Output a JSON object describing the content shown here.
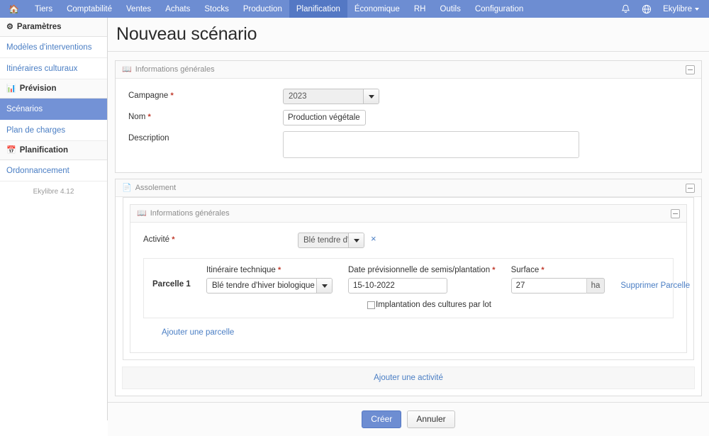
{
  "topnav": {
    "home_icon": "home-icon",
    "items": [
      {
        "label": "Tiers",
        "active": false
      },
      {
        "label": "Comptabilité",
        "active": false
      },
      {
        "label": "Ventes",
        "active": false
      },
      {
        "label": "Achats",
        "active": false
      },
      {
        "label": "Stocks",
        "active": false
      },
      {
        "label": "Production",
        "active": false
      },
      {
        "label": "Planification",
        "active": true
      },
      {
        "label": "Économique",
        "active": false
      },
      {
        "label": "RH",
        "active": false
      },
      {
        "label": "Outils",
        "active": false
      },
      {
        "label": "Configuration",
        "active": false
      }
    ],
    "bell_icon": "bell-icon",
    "globe_icon": "globe-icon",
    "user_label": "Ekylibre",
    "accent_color": "#6d8dd2",
    "active_color": "#5478c4"
  },
  "sidebar": {
    "sections": [
      {
        "title": "Paramètres",
        "icon": "gear-icon",
        "links": [
          {
            "label": "Modèles d'interventions",
            "selected": false
          },
          {
            "label": "Itinéraires culturaux",
            "selected": false
          }
        ]
      },
      {
        "title": "Prévision",
        "icon": "chart-bar-icon",
        "links": [
          {
            "label": "Scénarios",
            "selected": true
          },
          {
            "label": "Plan de charges",
            "selected": false
          }
        ]
      },
      {
        "title": "Planification",
        "icon": "calendar-icon",
        "links": [
          {
            "label": "Ordonnancement",
            "selected": false
          }
        ]
      }
    ],
    "version": "Ekylibre 4.12",
    "selected_bg": "#7392d6",
    "link_color": "#4a7ec4"
  },
  "page": {
    "title": "Nouveau scénario"
  },
  "panel_infos": {
    "icon": "book-icon",
    "title": "Informations générales",
    "collapse_icon": "collapse-minus-icon",
    "fields": {
      "campagne": {
        "label": "Campagne",
        "required_mark": "*",
        "value": "2023",
        "dropdown_icon": "chevron-down-icon"
      },
      "nom": {
        "label": "Nom",
        "required_mark": "*",
        "value": "Production végétale",
        "placeholder": ""
      },
      "description": {
        "label": "Description",
        "value": "",
        "placeholder": ""
      }
    }
  },
  "panel_assolement": {
    "icon": "file-icon",
    "title": "Assolement",
    "collapse_icon": "collapse-minus-icon",
    "inner": {
      "icon": "book-icon",
      "title": "Informations générales",
      "collapse_icon": "collapse-minus-icon",
      "activite": {
        "label": "Activité",
        "required_mark": "*",
        "value": "Blé tendre d'hiv",
        "dropdown_icon": "chevron-down-icon",
        "remove_icon": "×"
      },
      "parcelle": {
        "name": "Parcelle 1",
        "itineraire": {
          "label": "Itinéraire technique",
          "required_mark": "*",
          "value": "Blé tendre d'hiver biologique",
          "dropdown_icon": "chevron-down-icon"
        },
        "date": {
          "label": "Date prévisionnelle de semis/plantation",
          "required_mark": "*",
          "value": "15-10-2022"
        },
        "surface": {
          "label": "Surface",
          "required_mark": "*",
          "value": "27",
          "unit": "ha"
        },
        "delete_label": "Supprimer Parcelle",
        "checkbox": {
          "label": "Implantation des cultures par lot",
          "checked": false
        }
      },
      "add_parcelle_label": "Ajouter une parcelle"
    },
    "add_activite_label": "Ajouter une activité"
  },
  "footer": {
    "submit_label": "Créer",
    "cancel_label": "Annuler"
  }
}
